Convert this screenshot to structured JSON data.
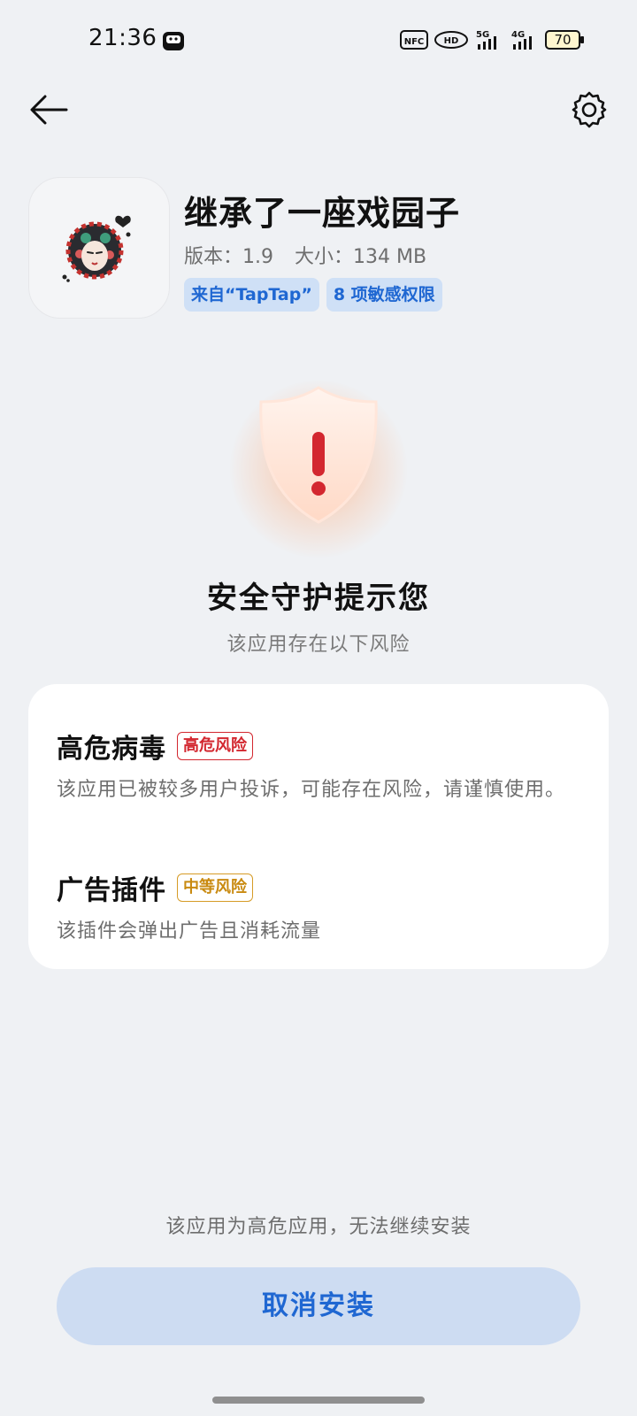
{
  "status_bar": {
    "time": "21:36",
    "nfc_label": "NFC",
    "hd_label": "HD",
    "network_1": "5G",
    "network_2": "4G",
    "battery": "70",
    "icons": [
      "app-notification-icon",
      "nfc-icon",
      "hd-voice-icon",
      "signal-5g-icon",
      "signal-4g-icon",
      "battery-icon"
    ]
  },
  "top_bar": {
    "back_icon": "arrow-left-icon",
    "settings_icon": "gear-icon"
  },
  "app": {
    "name": "继承了一座戏园子",
    "version_label": "版本：",
    "version": "1.9",
    "size_label": "大小：",
    "size": "134 MB",
    "tags": [
      "来自“TapTap”",
      "8 项敏感权限"
    ]
  },
  "warning": {
    "icon": "shield-warning-icon",
    "title": "安全守护提示您",
    "subtitle": "该应用存在以下风险"
  },
  "risks": [
    {
      "title": "高危病毒",
      "badge": "高危风险",
      "level": "high",
      "description": "该应用已被较多用户投诉，可能存在风险，请谨慎使用。"
    },
    {
      "title": "广告插件",
      "badge": "中等风险",
      "level": "medium",
      "description": "该插件会弹出广告且消耗流量"
    }
  ],
  "footer": {
    "note": "该应用为高危应用，无法继续安装",
    "cancel_label": "取消安装"
  },
  "colors": {
    "background": "#eff1f4",
    "accent_blue": "#1f67d2",
    "tag_bg": "#cfe0f6",
    "button_bg": "#cddcf2",
    "high_risk": "#d3272f",
    "medium_risk": "#c98a10"
  }
}
